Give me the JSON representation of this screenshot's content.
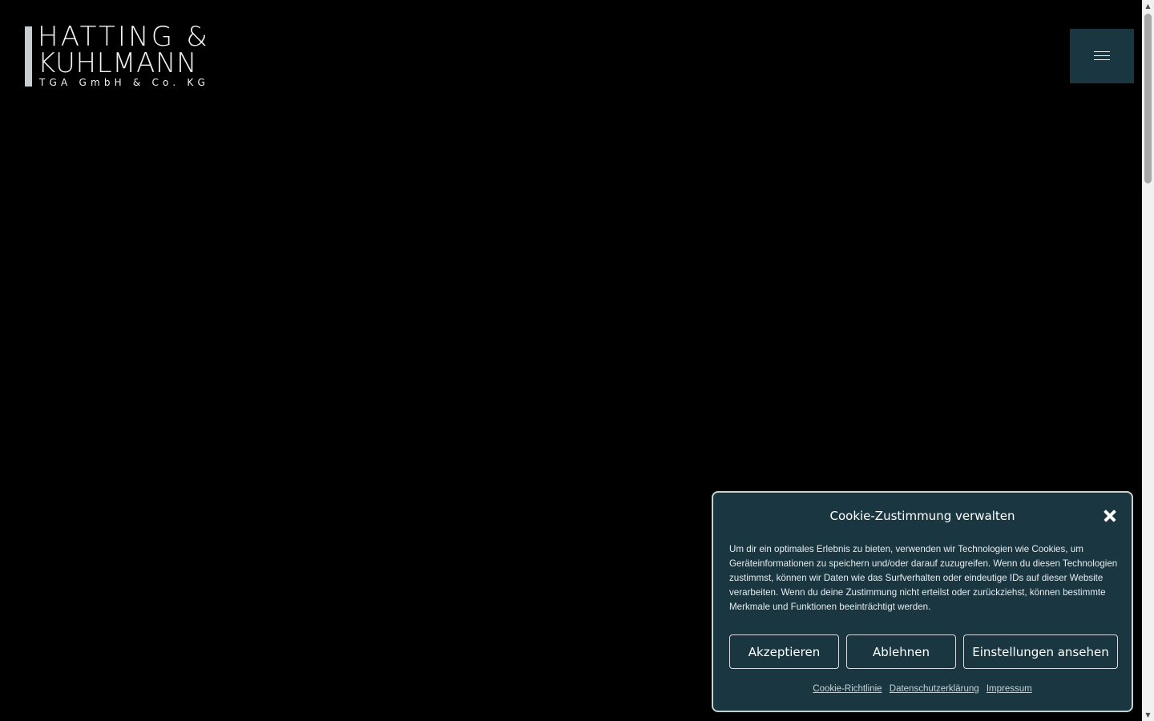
{
  "header": {
    "logo": {
      "line1": "HATTING &",
      "line2": "KUHLMANN",
      "line3": "TGA GmbH & Co. KG"
    },
    "menu_icon": "hamburger-menu-icon"
  },
  "cookie_banner": {
    "title": "Cookie-Zustimmung verwalten",
    "text": "Um dir ein optimales Erlebnis zu bieten, verwenden wir Technologien wie Cookies, um Geräteinformationen zu speichern und/oder darauf zuzugreifen. Wenn du diesen Technologien zustimmst, können wir Daten wie das Surfverhalten oder eindeutige IDs auf dieser Website verarbeiten. Wenn du deine Zustimmung nicht erteilst oder zurückziehst, können bestimmte Merkmale und Funktionen beeinträchtigt werden.",
    "buttons": {
      "accept": "Akzeptieren",
      "deny": "Ablehnen",
      "settings": "Einstellungen ansehen"
    },
    "links": {
      "cookie_policy": "Cookie-Richtlinie",
      "privacy": "Datenschutzerklärung",
      "imprint": "Impressum"
    }
  },
  "colors": {
    "background": "#000000",
    "panel": "#1a3640",
    "logo_bar": "#c9ced3",
    "text": "#ffffff"
  }
}
